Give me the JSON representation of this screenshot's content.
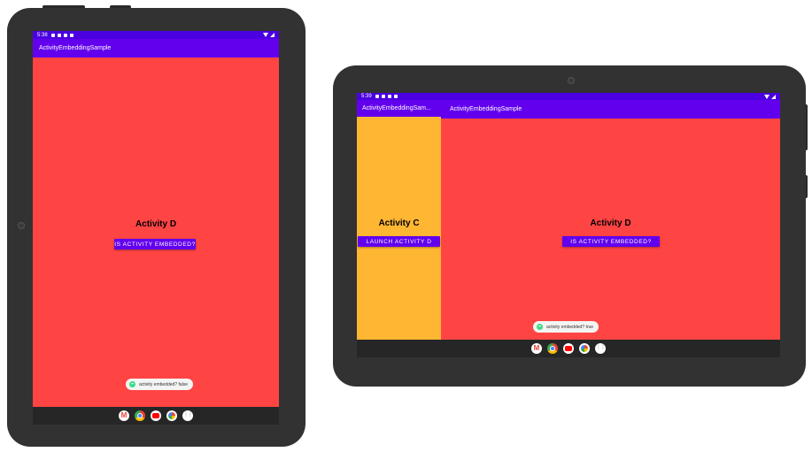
{
  "portrait": {
    "status_time": "5:38",
    "app_title": "ActivityEmbeddingSample",
    "heading": "Activity D",
    "button_label": "IS ACTIVITY EMBEDDED?",
    "toast_text": "activity embedded? false"
  },
  "landscape": {
    "status_time": "5:39",
    "left_app_title": "ActivityEmbeddingSam...",
    "right_app_title": "ActivityEmbeddingSample",
    "left_heading": "Activity C",
    "left_button_label": "LAUNCH ACTIVITY D",
    "right_heading": "Activity D",
    "right_button_label": "IS ACTIVITY EMBEDDED?",
    "toast_text": "activity embedded? true"
  },
  "taskbar_apps": [
    "gmail-icon",
    "chrome-icon",
    "youtube-icon",
    "photos-icon",
    "app-launcher-icon"
  ],
  "colors": {
    "status_bar": "#4a00e0",
    "app_bar": "#6200ee",
    "activity_d_bg": "#ff4444",
    "activity_c_bg": "#ffb733",
    "button": "#6200ee",
    "taskbar": "#262626",
    "device": "#323232"
  }
}
